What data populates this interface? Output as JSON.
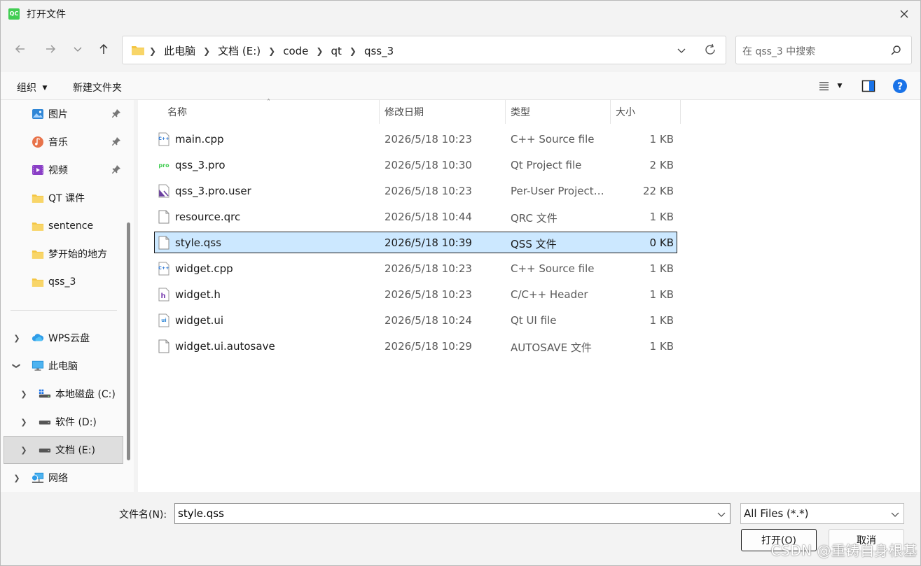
{
  "window": {
    "title": "打开文件",
    "app_logo": "QC"
  },
  "address": {
    "crumbs": [
      "此电脑",
      "文档 (E:)",
      "code",
      "qt",
      "qss_3"
    ]
  },
  "search": {
    "placeholder": "在 qss_3 中搜索"
  },
  "toolbar": {
    "organize": "组织",
    "new_folder": "新建文件夹"
  },
  "sidebar": {
    "quick": [
      {
        "label": "图片",
        "icon": "pictures-icon",
        "pinned": true
      },
      {
        "label": "音乐",
        "icon": "music-icon",
        "pinned": true
      },
      {
        "label": "视频",
        "icon": "videos-icon",
        "pinned": true
      },
      {
        "label": "QT 课件",
        "icon": "folder-icon",
        "pinned": false
      },
      {
        "label": "sentence",
        "icon": "folder-icon",
        "pinned": false
      },
      {
        "label": "梦开始的地方",
        "icon": "folder-icon",
        "pinned": false
      },
      {
        "label": "qss_3",
        "icon": "folder-icon",
        "pinned": false
      }
    ],
    "tree": [
      {
        "label": "WPS云盘",
        "icon": "cloud-icon",
        "expander": "collapsed"
      },
      {
        "label": "此电脑",
        "icon": "computer-icon",
        "expander": "expanded"
      },
      {
        "label": "本地磁盘 (C:)",
        "icon": "drive-icon",
        "expander": "collapsed"
      },
      {
        "label": "软件 (D:)",
        "icon": "drive-icon",
        "expander": "collapsed"
      },
      {
        "label": "文档 (E:)",
        "icon": "drive-icon",
        "expander": "collapsed",
        "selected": true
      },
      {
        "label": "网络",
        "icon": "network-icon",
        "expander": "collapsed"
      }
    ]
  },
  "columns": {
    "name": "名称",
    "date": "修改日期",
    "type": "类型",
    "size": "大小"
  },
  "files": [
    {
      "name": "main.cpp",
      "date": "2026/5/18 10:23",
      "type": "C++ Source file",
      "size": "1 KB",
      "icon": "cpp-file-icon"
    },
    {
      "name": "qss_3.pro",
      "date": "2026/5/18 10:30",
      "type": "Qt Project file",
      "size": "2 KB",
      "icon": "pro-file-icon"
    },
    {
      "name": "qss_3.pro.user",
      "date": "2026/5/18 10:23",
      "type": "Per-User Project…",
      "size": "22 KB",
      "icon": "user-file-icon"
    },
    {
      "name": "resource.qrc",
      "date": "2026/5/18 10:44",
      "type": "QRC 文件",
      "size": "1 KB",
      "icon": "blank-file-icon"
    },
    {
      "name": "style.qss",
      "date": "2026/5/18 10:39",
      "type": "QSS 文件",
      "size": "0 KB",
      "icon": "blank-file-icon",
      "selected": true
    },
    {
      "name": "widget.cpp",
      "date": "2026/5/18 10:23",
      "type": "C++ Source file",
      "size": "1 KB",
      "icon": "cpp-file-icon"
    },
    {
      "name": "widget.h",
      "date": "2026/5/18 10:23",
      "type": "C/C++ Header",
      "size": "1 KB",
      "icon": "header-file-icon"
    },
    {
      "name": "widget.ui",
      "date": "2026/5/18 10:24",
      "type": "Qt UI file",
      "size": "1 KB",
      "icon": "ui-file-icon"
    },
    {
      "name": "widget.ui.autosave",
      "date": "2026/5/18 10:29",
      "type": "AUTOSAVE 文件",
      "size": "1 KB",
      "icon": "blank-file-icon"
    }
  ],
  "bottom": {
    "filename_label": "文件名(N):",
    "filename_value": "style.qss",
    "filter_value": "All Files (*.*)",
    "open_label": "打开(O)",
    "cancel_label": "取消"
  },
  "watermark": "CSDN @重铸自身根基",
  "colors": {
    "selection": "#cce8ff",
    "folder": "#f4c542",
    "help": "#1a73e8",
    "qt_green": "#41cd52"
  }
}
